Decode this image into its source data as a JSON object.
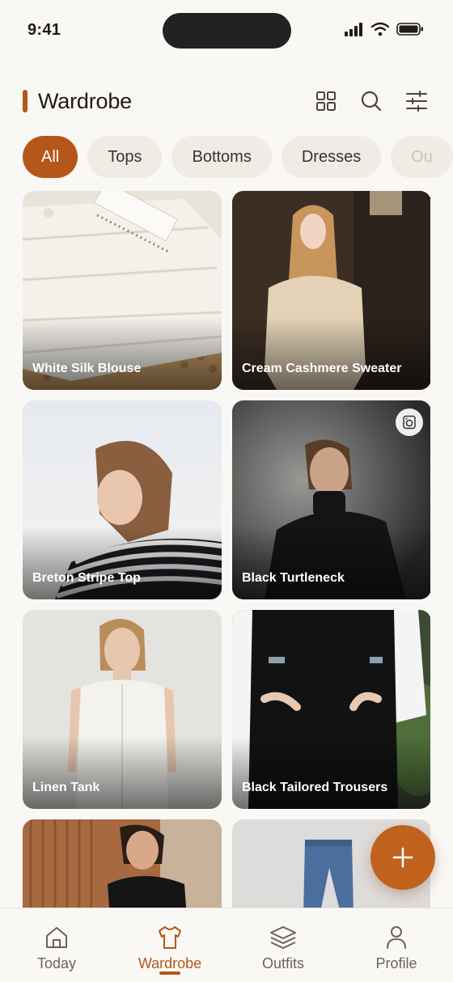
{
  "status_bar": {
    "time": "9:41"
  },
  "header": {
    "title": "Wardrobe"
  },
  "filters": [
    "All",
    "Tops",
    "Bottoms",
    "Dresses",
    "Ou"
  ],
  "items": [
    {
      "label": "White Silk Blouse"
    },
    {
      "label": "Cream Cashmere Sweater"
    },
    {
      "label": "Breton Stripe Top"
    },
    {
      "label": "Black Turtleneck"
    },
    {
      "label": "Linen Tank"
    },
    {
      "label": "Black Tailored Trousers"
    },
    {
      "label": ""
    },
    {
      "label": ""
    }
  ],
  "nav": {
    "today": "Today",
    "wardrobe": "Wardrobe",
    "outfits": "Outfits",
    "profile": "Profile"
  },
  "colors": {
    "accent": "#b5561b",
    "background": "#faf8f5",
    "chip": "#f1ebe5"
  }
}
